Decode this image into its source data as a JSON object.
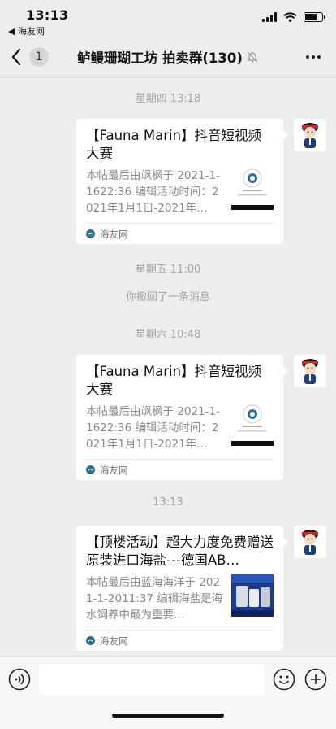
{
  "status_bar": {
    "time": "13:13",
    "back_app": "◀ 海友网"
  },
  "nav": {
    "unread_count": "1",
    "title": "鲈鳗珊瑚工坊 拍卖群(130)"
  },
  "chat": {
    "time_labels": [
      "星期四 13:18",
      "星期五 11:00",
      "星期六 10:48",
      "13:13"
    ],
    "system_message": "你撤回了一条消息",
    "messages": [
      {
        "title": "【Fauna Marin】抖音短视频大赛",
        "desc": "本帖最后由飒枫于 2021-1-1622:36 编辑活动时间：2021年1月1日-2021年…",
        "source": "海友网",
        "thumb": "qr"
      },
      {
        "title": "【Fauna Marin】抖音短视频大赛",
        "desc": "本帖最后由飒枫于 2021-1-1622:36 编辑活动时间：2021年1月1日-2021年…",
        "source": "海友网",
        "thumb": "qr"
      },
      {
        "title": "【顶楼活动】超大力度免费赠送原装进口海盐---德国AB…",
        "desc": "本帖最后由蓝海海洋于 2021-1-2011:37 编辑海盐是海水饲养中最为重要…",
        "source": "海友网",
        "thumb": "product"
      }
    ]
  },
  "input": {
    "placeholder": ""
  },
  "colors": {
    "background": "#ededed",
    "card": "#ffffff",
    "secondary_text": "#a3a3a3"
  }
}
